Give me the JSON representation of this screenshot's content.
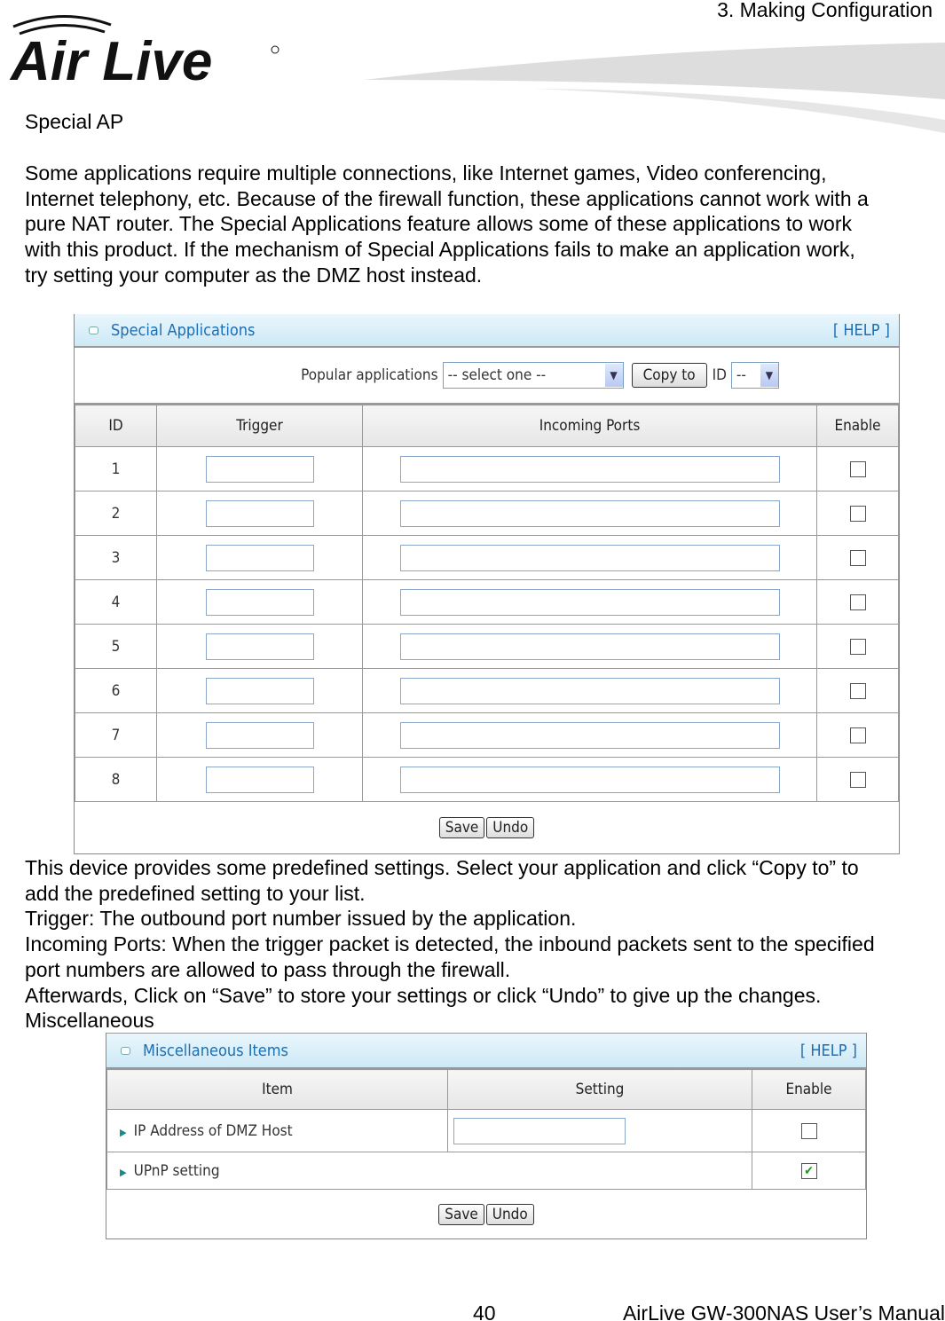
{
  "header": {
    "chapter": "3.  Making  Configuration",
    "logo_text": "Air Live"
  },
  "section_title": "Special AP",
  "intro_lines": [
    "Some applications require multiple connections, like Internet games, Video conferencing,",
    "Internet telephony, etc. Because of the firewall function, these applications cannot work with a",
    "pure NAT router. The Special Applications feature allows some of these applications to work",
    "with this product. If the mechanism of Special Applications fails to make an application work,",
    "try setting your computer as the DMZ host instead."
  ],
  "special": {
    "title": "Special Applications",
    "help": "[ HELP ]",
    "popular_label": "Popular applications",
    "select_value": "-- select one --",
    "copy_label": "Copy to",
    "id_label": "ID",
    "id_value": "--",
    "columns": [
      "ID",
      "Trigger",
      "Incoming Ports",
      "Enable"
    ],
    "rows": [
      "1",
      "2",
      "3",
      "4",
      "5",
      "6",
      "7",
      "8"
    ],
    "save": "Save",
    "undo": "Undo"
  },
  "desc_lines": [
    "This device provides some predefined settings. Select your application and click “Copy to” to",
    "add the predefined setting to your list.",
    "Trigger: The outbound port number issued by the application.",
    "Incoming Ports: When the trigger packet is detected, the inbound packets sent to the specified",
    "port numbers are allowed to pass through the firewall.",
    "Afterwards, Click on “Save” to store your settings or click “Undo” to give up the changes.",
    "Miscellaneous"
  ],
  "misc": {
    "title": "Miscellaneous Items",
    "help": "[ HELP ]",
    "columns": [
      "Item",
      "Setting",
      "Enable"
    ],
    "dmz_label": "IP Address of DMZ Host",
    "dmz_enabled": false,
    "upnp_label": "UPnP setting",
    "upnp_enabled": true,
    "save": "Save",
    "undo": "Undo"
  },
  "footer": {
    "page": "40",
    "manual": "AirLive GW-300NAS User’s Manual"
  },
  "colors": {
    "title_blue": "#1a6fb5",
    "check_green": "#1a9a1a"
  }
}
